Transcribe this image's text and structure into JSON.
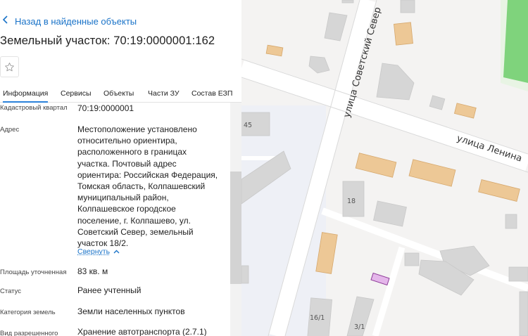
{
  "header": {
    "back_label": "Назад в найденные объекты",
    "title": "Земельный участок: 70:19:0000001:162"
  },
  "tabs": [
    {
      "label": "Информация",
      "active": true
    },
    {
      "label": "Сервисы",
      "active": false
    },
    {
      "label": "Объекты",
      "active": false
    },
    {
      "label": "Части ЗУ",
      "active": false
    },
    {
      "label": "Состав ЕЗП",
      "active": false
    }
  ],
  "info": {
    "rows": [
      {
        "label": "Кадастровый квартал",
        "value": "70:19:0000001"
      },
      {
        "label": "Адрес",
        "value_lines": [
          "Местоположение установлено",
          "относительно ориентира,",
          "расположенного в границах",
          "участка. Почтовый адрес",
          "ориентира: Российская Федерация,",
          "Томская область, Колпашевский",
          "муниципальный район,",
          "Колпашевское городское",
          "поселение, г. Колпашево, ул.",
          "Советский Север, земельный",
          "участок 18/2."
        ]
      },
      {
        "label": "Площадь уточненная",
        "value": "83 кв. м"
      },
      {
        "label": "Статус",
        "value": "Ранее учтенный"
      },
      {
        "label": "Категория земель",
        "value": "Земли населенных пунктов"
      },
      {
        "label": "Вид разрешенного",
        "value": "Хранение автотранспорта (2.7.1)"
      }
    ],
    "collapse_label": "Свернуть"
  },
  "map": {
    "streets": [
      "улица Советский Север",
      "улица Ленина"
    ],
    "house_numbers": [
      "45",
      "18",
      "16/1",
      "3/1"
    ],
    "colors": {
      "background": "#f4f3f2",
      "road": "#ffffff",
      "building": "#d6d6d6",
      "building_highlight": "#edc896",
      "selected_parcel": "#e4b6ea",
      "park": "#7fd37c",
      "water_area": "#eef0f6"
    }
  },
  "icons": {
    "back": "chevron-left-icon",
    "favorite": "star-icon",
    "collapse": "chevron-up-icon"
  },
  "colors": {
    "accent": "#1a73c8",
    "tab_underline": "#2b82d9"
  }
}
